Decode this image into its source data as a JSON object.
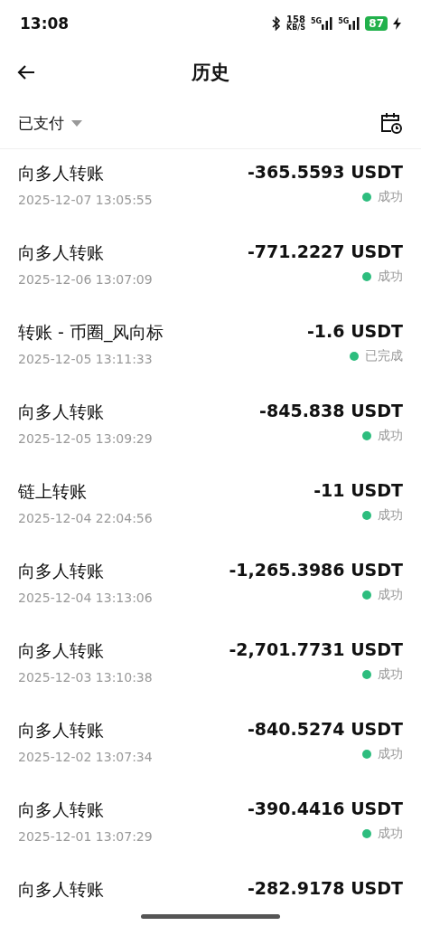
{
  "status_bar": {
    "time": "13:08",
    "speed": "158",
    "speed_unit": "KB/S",
    "networks": [
      "5G",
      "5G"
    ],
    "battery": "87",
    "charging": true
  },
  "header": {
    "title": "历史"
  },
  "filter": {
    "label": "已支付"
  },
  "transactions": [
    {
      "title": "向多人转账",
      "time": "2025-12-07 13:05:55",
      "amount": "-365.5593 USDT",
      "status": "成功",
      "color": "#2dbd7e"
    },
    {
      "title": "向多人转账",
      "time": "2025-12-06 13:07:09",
      "amount": "-771.2227 USDT",
      "status": "成功",
      "color": "#2dbd7e"
    },
    {
      "title": "转账 - 币圈_风向标",
      "time": "2025-12-05 13:11:33",
      "amount": "-1.6 USDT",
      "status": "已完成",
      "color": "#2dbd7e"
    },
    {
      "title": "向多人转账",
      "time": "2025-12-05 13:09:29",
      "amount": "-845.838 USDT",
      "status": "成功",
      "color": "#2dbd7e"
    },
    {
      "title": "链上转账",
      "time": "2025-12-04 22:04:56",
      "amount": "-11 USDT",
      "status": "成功",
      "color": "#2dbd7e"
    },
    {
      "title": "向多人转账",
      "time": "2025-12-04 13:13:06",
      "amount": "-1,265.3986 USDT",
      "status": "成功",
      "color": "#2dbd7e"
    },
    {
      "title": "向多人转账",
      "time": "2025-12-03 13:10:38",
      "amount": "-2,701.7731 USDT",
      "status": "成功",
      "color": "#2dbd7e"
    },
    {
      "title": "向多人转账",
      "time": "2025-12-02 13:07:34",
      "amount": "-840.5274 USDT",
      "status": "成功",
      "color": "#2dbd7e"
    },
    {
      "title": "向多人转账",
      "time": "2025-12-01 13:07:29",
      "amount": "-390.4416 USDT",
      "status": "成功",
      "color": "#2dbd7e"
    },
    {
      "title": "向多人转账",
      "amount": "-282.9178 USDT"
    }
  ]
}
